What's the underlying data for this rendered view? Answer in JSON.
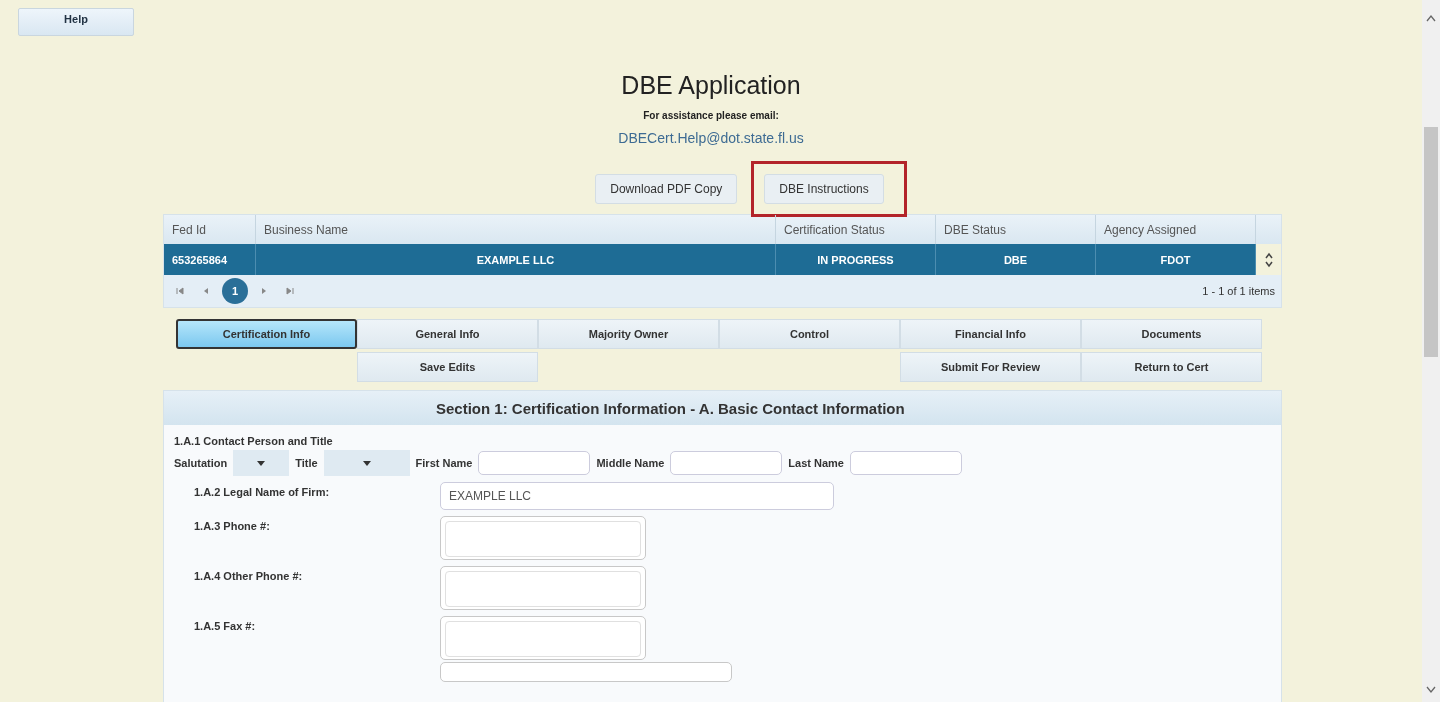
{
  "help_button": "Help",
  "header": {
    "title": "DBE Application",
    "assistance": "For assistance please email:",
    "email": "DBECert.Help@dot.state.fl.us"
  },
  "top_buttons": [
    {
      "label": "Download PDF Copy",
      "highlighted": false
    },
    {
      "label": "DBE Instructions",
      "highlighted": true
    }
  ],
  "table": {
    "columns": [
      "Fed Id",
      "Business Name",
      "Certification Status",
      "DBE Status",
      "Agency Assigned"
    ],
    "rows": [
      {
        "selected": true,
        "cells": [
          "653265864",
          "EXAMPLE LLC",
          "IN PROGRESS",
          "DBE",
          "FDOT"
        ]
      }
    ],
    "pager": {
      "pages": [
        {
          "label": "1",
          "selected": true
        }
      ],
      "summary": "1 - 1 of 1 items"
    }
  },
  "tabs": [
    {
      "label": "Certification Info",
      "selected": true
    },
    {
      "label": "General Info",
      "selected": false
    },
    {
      "label": "Majority Owner",
      "selected": false
    },
    {
      "label": "Control",
      "selected": false
    },
    {
      "label": "Financial Info",
      "selected": false
    },
    {
      "label": "Documents",
      "selected": false
    }
  ],
  "actions": [
    {
      "label": "Save Edits"
    },
    {
      "label": "Submit For Review"
    },
    {
      "label": "Return to Cert"
    }
  ],
  "section": {
    "title": "Section 1: Certification Information - A. Basic Contact Information",
    "contact": {
      "label": "1.A.1 Contact Person and Title",
      "fields": [
        {
          "kind": "select",
          "label": "Salutation"
        },
        {
          "kind": "select",
          "label": "Title"
        },
        {
          "kind": "text",
          "label": "First Name"
        },
        {
          "kind": "text",
          "label": "Middle Name"
        },
        {
          "kind": "text",
          "label": "Last Name"
        }
      ]
    },
    "fields": [
      {
        "kind": "wide",
        "label": "1.A.2 Legal Name of Firm:",
        "value": "EXAMPLE LLC"
      },
      {
        "kind": "short",
        "label": "1.A.3 Phone #:"
      },
      {
        "kind": "short",
        "label": "1.A.4 Other Phone #:"
      },
      {
        "kind": "short",
        "label": "1.A.5 Fax #:"
      }
    ]
  }
}
